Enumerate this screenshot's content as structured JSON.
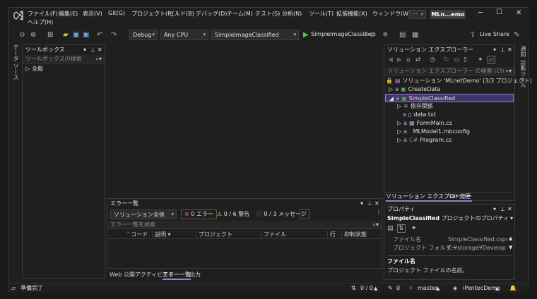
{
  "menu": [
    "ファイル(F)",
    "編集(E)",
    "表示(V)",
    "Git(G)",
    "プロジェクト(P)",
    "ビルド(B)",
    "デバッグ(D)",
    "チーム(M)",
    "テスト(S)",
    "分析(N)",
    "ツール(T)",
    "拡張機能(X)",
    "ウィンドウ(W)"
  ],
  "menu_help": "ヘルプ(H)",
  "window_title": "MLn...emo",
  "search_label": "...",
  "toolbar": {
    "config": "Debug",
    "platform": "Any CPU",
    "startup": "SimpleImageClassified",
    "run_label": "SimpleImageClassified",
    "live_share": "Live Share"
  },
  "left_vtab": "データ ソース",
  "toolbox": {
    "title": "ツールボックス",
    "search": "ツールボックスの検索",
    "group": "全般"
  },
  "solution_explorer": {
    "title": "ソリューション エクスプローラー",
    "search": "ソリューション エクスプローラー の検索 (Ctrl+;)",
    "items": [
      {
        "label": "ソリューション 'MLnetDemo' (3/3 プロジェクト)"
      },
      {
        "label": "CreateData"
      },
      {
        "label": "SimpleClassified"
      },
      {
        "label": "依存関係"
      },
      {
        "label": "data.txt"
      },
      {
        "label": "FormMain.cs"
      },
      {
        "label": "MLModel1.mbconfig"
      },
      {
        "label": "Program.cs"
      }
    ],
    "tabs": [
      "ソリューション エクスプローラー",
      "Git 変更"
    ]
  },
  "right_vtabs": [
    "通知",
    "診断ツール"
  ],
  "properties": {
    "title": "プロパティ",
    "subject_bold": "SimpleClassified",
    "subject_rest": " プロジェクトのプロパティ",
    "rows": [
      {
        "name": "ファイル名",
        "value": "SimpleClassified.csproj"
      },
      {
        "name": "プロジェクト フォルダー",
        "value": "C:¥storage¥Develop Repo"
      }
    ],
    "desc_title": "ファイル名",
    "desc_text": "プロジェクト ファイルの名前。"
  },
  "error_list": {
    "title": "エラー一覧",
    "scope": "ソリューション全体",
    "errors": "0 エラー",
    "warnings": "0 / 6 警告",
    "messages": "0 / 3 メッセージ",
    "search": "エラー一覧を検索",
    "columns": [
      "コード",
      "説明",
      "プロジェクト",
      "ファイル",
      "行",
      "抑制状態"
    ]
  },
  "bottom_tabs": [
    "Web 公開アクティビティ",
    "エラー一覧",
    "出力"
  ],
  "status": {
    "ready": "準備完了",
    "lines": "0 / 0",
    "changes": "0",
    "branch": "master",
    "repo": "iPentecDemo"
  },
  "colors": {
    "accent": "#9b7bd4",
    "selected_bg": "#3f3566",
    "error": "#e05252",
    "warning": "#e8c43a",
    "info": "#4aa0e6",
    "run_green": "#4ec94e"
  }
}
